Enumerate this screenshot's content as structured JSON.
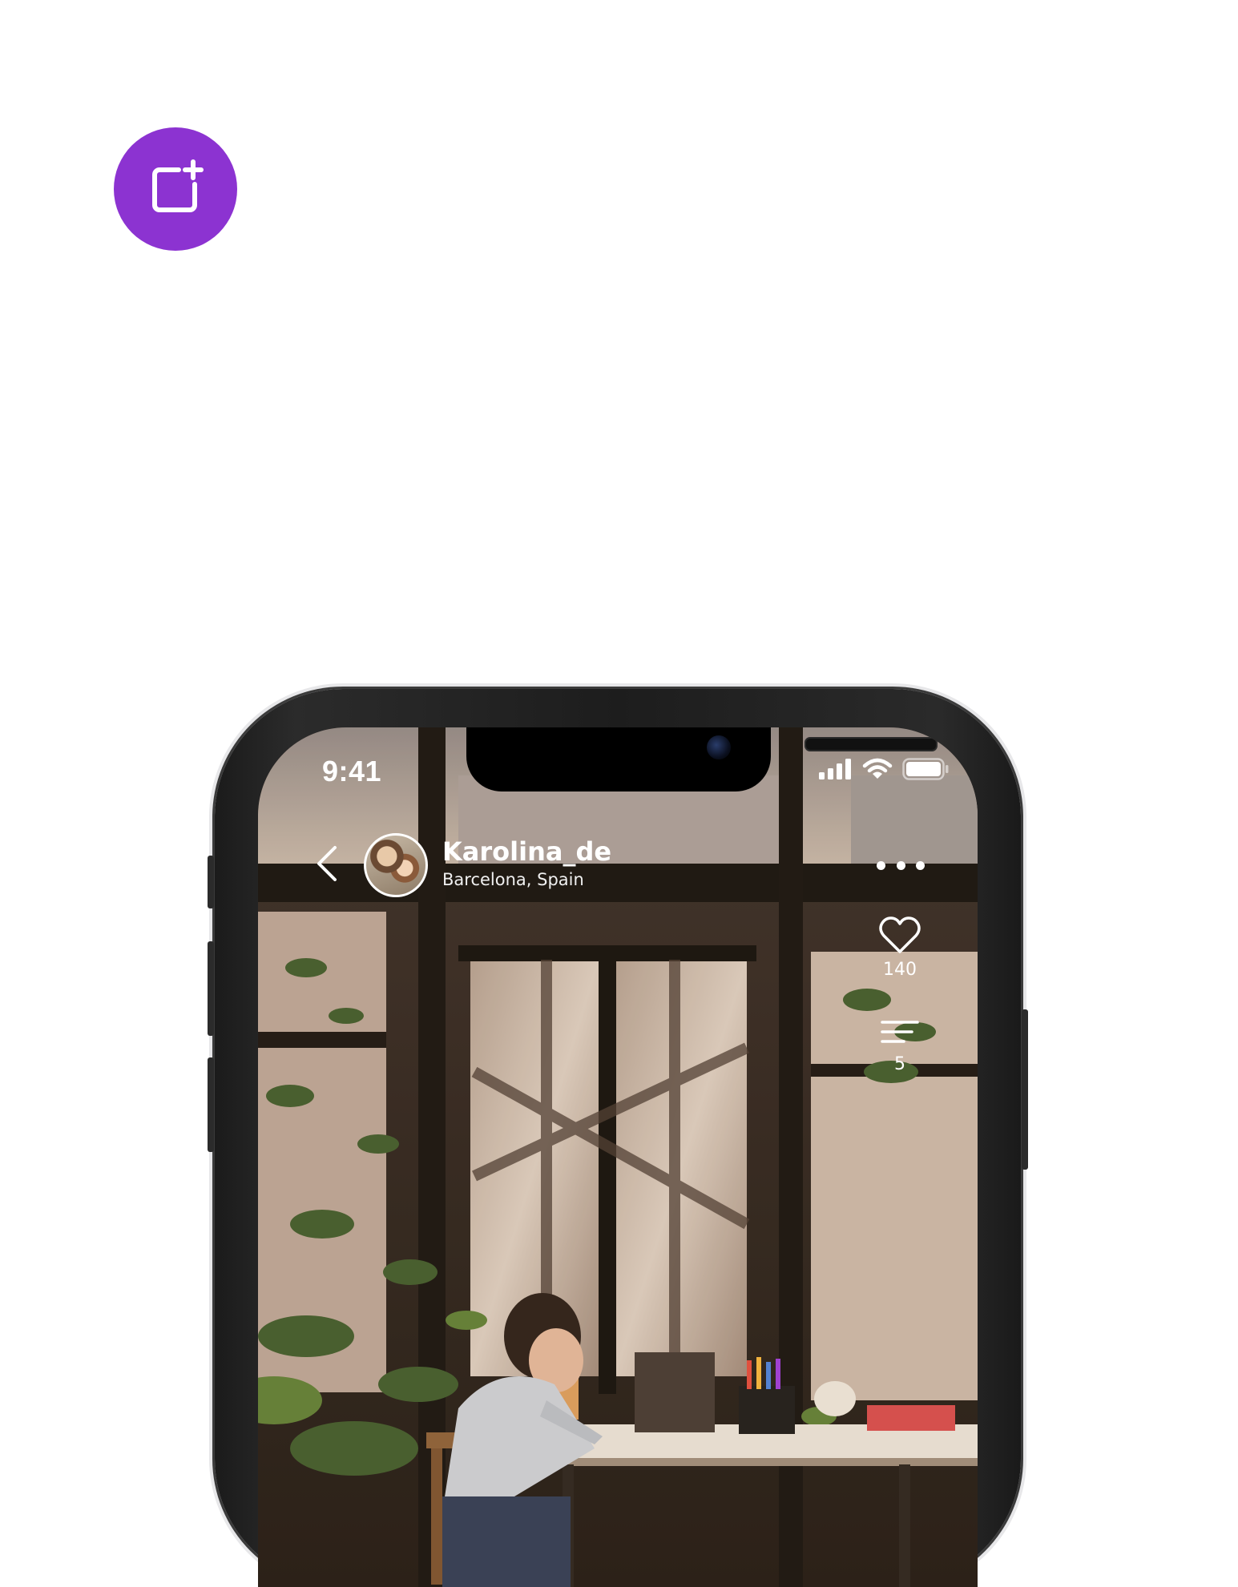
{
  "status_bar": {
    "time": "9:41"
  },
  "post": {
    "username": "Karolina_de",
    "location": "Barcelona, Spain"
  },
  "actions": {
    "likes": "140",
    "comments": "5"
  },
  "icons": {
    "badge": "add-post-icon",
    "back": "chevron-left-icon",
    "more": "more-dots-icon",
    "like": "heart-icon",
    "comment": "comment-lines-icon",
    "signal": "cellular-signal-icon",
    "wifi": "wifi-icon",
    "battery": "battery-icon"
  },
  "colors": {
    "accent": "#8C33D1",
    "phone_frame": "#1D1D1D",
    "overlay_text": "#FFFFFF"
  }
}
